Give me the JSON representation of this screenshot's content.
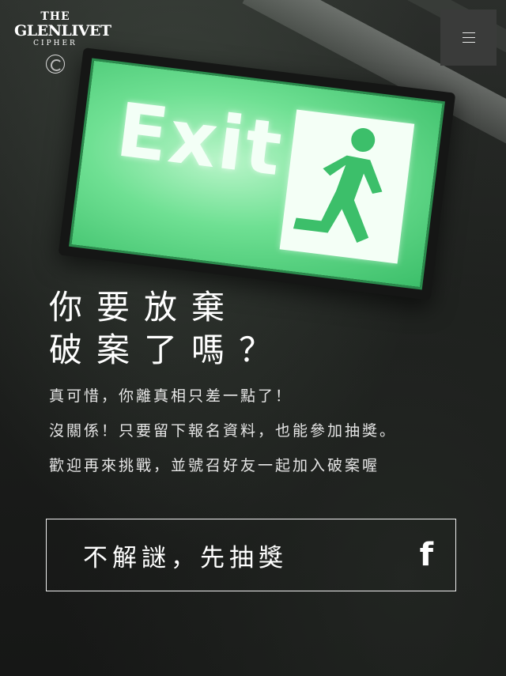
{
  "logo": {
    "line1": "THE",
    "line2": "GLENLIVET",
    "line3": "CIPHER"
  },
  "menu": {
    "icon": "hamburger-icon"
  },
  "sign": {
    "text": "Exit",
    "icon": "running-man-icon"
  },
  "headline": {
    "line1": "你要放棄",
    "line2": "破案了嗎？"
  },
  "body": {
    "line1": "真可惜，你離真相只差一點了！",
    "line2": "沒關係！只要留下報名資料，也能參加抽獎。",
    "line3": "歡迎再來挑戰，並號召好友一起加入破案喔"
  },
  "cta": {
    "label": "不解謎，先抽獎",
    "icon": "facebook-icon",
    "icon_glyph": "f"
  },
  "colors": {
    "background": "#1f211f",
    "sign_green": "#6fe093",
    "text": "#ffffff"
  }
}
